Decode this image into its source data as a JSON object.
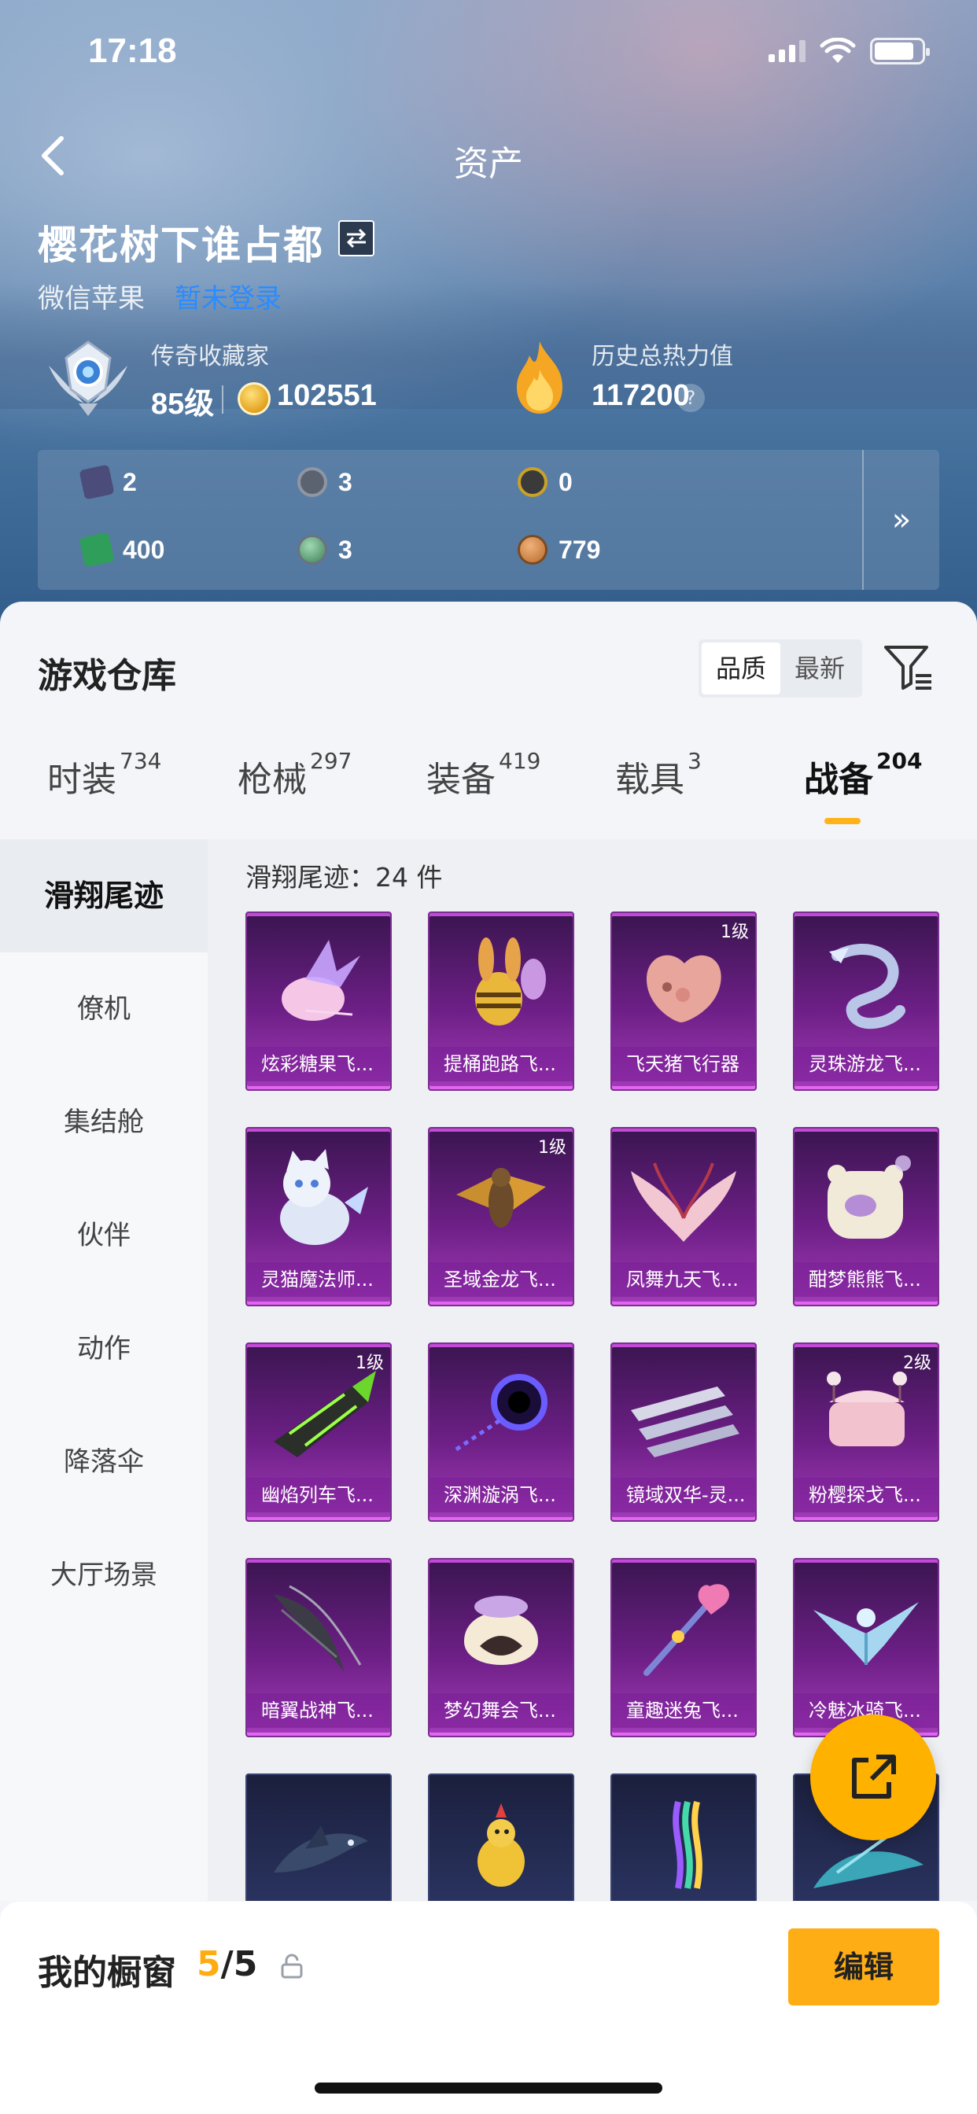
{
  "status": {
    "time": "17:18"
  },
  "nav": {
    "title": "资产"
  },
  "user": {
    "name": "樱花树下谁占都",
    "platform": "微信苹果",
    "platform_link": "暂未登录"
  },
  "rank": {
    "title": "传奇收藏家",
    "level": "85级",
    "coins": "102551"
  },
  "heat": {
    "title": "历史总热力值",
    "value": "117200",
    "help": "?"
  },
  "resources": [
    {
      "icon": "card-icon",
      "value": "2",
      "color": "#4b4c7a"
    },
    {
      "icon": "token-icon",
      "value": "3",
      "color": "#5c6370"
    },
    {
      "icon": "gold-badge-icon",
      "value": "0",
      "color": "#c9a227"
    },
    {
      "icon": "ticket-icon",
      "value": "400",
      "color": "#2f9e5a"
    },
    {
      "icon": "green-orb-icon",
      "value": "3",
      "color": "#3f7f56"
    },
    {
      "icon": "bronze-coin-icon",
      "value": "779",
      "color": "#b86a2c"
    }
  ],
  "resources_more": "»",
  "warehouse": {
    "title": "游戏仓库",
    "sort": [
      "品质",
      "最新"
    ],
    "tabs": [
      {
        "label": "时装",
        "count": "734"
      },
      {
        "label": "枪械",
        "count": "297"
      },
      {
        "label": "装备",
        "count": "419"
      },
      {
        "label": "载具",
        "count": "3"
      },
      {
        "label": "战备",
        "count": "204"
      }
    ],
    "side": [
      "滑翔尾迹",
      "僚机",
      "集结舱",
      "伙伴",
      "动作",
      "降落伞",
      "大厅场景"
    ],
    "grid_title": "滑翔尾迹：24 件",
    "items": [
      {
        "name": "炫彩糖果飞...",
        "level": "",
        "icon": "candy-glider-icon"
      },
      {
        "name": "提桶跑路飞...",
        "level": "",
        "icon": "bee-bucket-icon"
      },
      {
        "name": "飞天猪飞行器",
        "level": "1级",
        "icon": "flying-pig-icon"
      },
      {
        "name": "灵珠游龙飞...",
        "level": "",
        "icon": "dragon-icon"
      },
      {
        "name": "灵猫魔法师...",
        "level": "",
        "icon": "magic-cat-icon"
      },
      {
        "name": "圣域金龙飞...",
        "level": "1级",
        "icon": "golden-dragon-icon"
      },
      {
        "name": "凤舞九天飞...",
        "level": "",
        "icon": "phoenix-wings-icon"
      },
      {
        "name": "酣梦熊熊飞...",
        "level": "",
        "icon": "sleepy-bear-icon"
      },
      {
        "name": "幽焰列车飞...",
        "level": "1级",
        "icon": "flame-train-icon"
      },
      {
        "name": "深渊漩涡飞...",
        "level": "",
        "icon": "abyss-vortex-icon"
      },
      {
        "name": "镜域双华-灵...",
        "level": "",
        "icon": "mirror-blades-icon"
      },
      {
        "name": "粉樱探戈飞...",
        "level": "2级",
        "icon": "sakura-tango-icon"
      },
      {
        "name": "暗翼战神飞...",
        "level": "",
        "icon": "dark-wings-icon"
      },
      {
        "name": "梦幻舞会飞...",
        "level": "",
        "icon": "dream-ball-icon"
      },
      {
        "name": "童趣迷兔飞...",
        "level": "",
        "icon": "bunny-wand-icon"
      },
      {
        "name": "冷魅冰骑飞...",
        "level": "",
        "icon": "ice-rider-icon"
      },
      {
        "name": "",
        "level": "",
        "icon": "shark-icon"
      },
      {
        "name": "",
        "level": "",
        "icon": "chicken-icon"
      },
      {
        "name": "",
        "level": "",
        "icon": "rainbow-trail-icon"
      },
      {
        "name": "",
        "level": "",
        "icon": "blue-fin-icon"
      }
    ]
  },
  "showcase": {
    "title": "我的橱窗",
    "used": "5",
    "total": "/5",
    "edit": "编辑"
  },
  "colors": {
    "accent": "#ffad14",
    "link": "#2a8cff",
    "card_purple": "#6d1f86"
  }
}
